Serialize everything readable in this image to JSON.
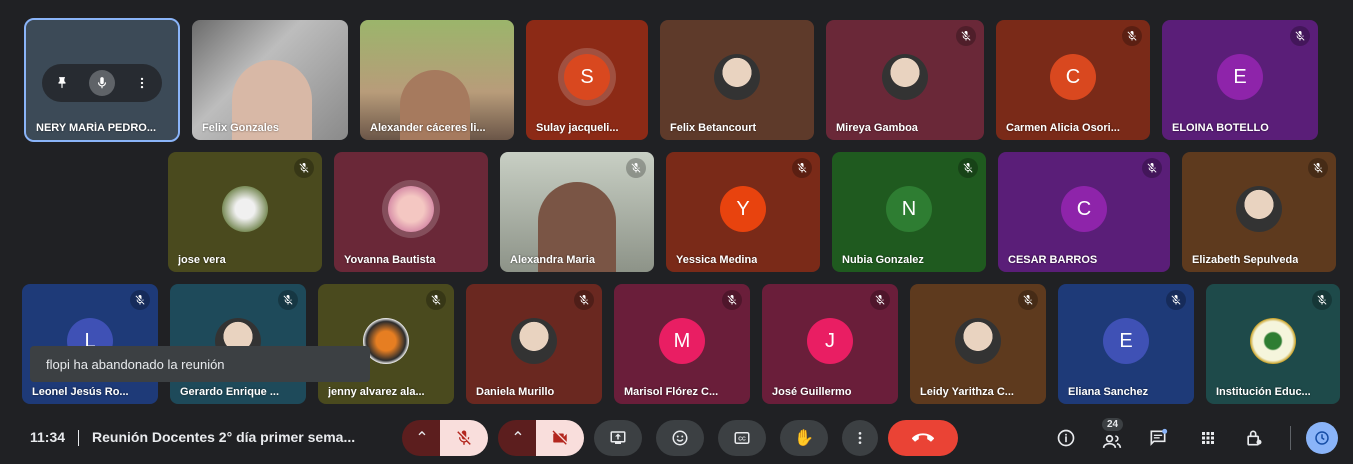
{
  "colors": {
    "accent": "#8ab4f8",
    "hangup": "#ea4335",
    "mute_bg": "#f9dedc",
    "bar_bg": "#202124"
  },
  "self_tile": {
    "name": "NERY MARÍA PEDRO..."
  },
  "self_controls": {
    "pin_icon": "pin-icon",
    "mic_icon": "mic-icon",
    "more_icon": "more-vert-icon"
  },
  "tiles": [
    {
      "name": "Felix Gonzales"
    },
    {
      "name": "Alexander cáceres li..."
    },
    {
      "name": "Sulay jacqueli...",
      "initial": "S"
    },
    {
      "name": "Felix Betancourt"
    },
    {
      "name": "Mireya Gamboa"
    },
    {
      "name": "Carmen Alicia Osori...",
      "initial": "C"
    },
    {
      "name": "ELOINA BOTELLO",
      "initial": "E"
    },
    {
      "name": "jose vera"
    },
    {
      "name": "Yovanna Bautista"
    },
    {
      "name": "Alexandra Maria"
    },
    {
      "name": "Yessica Medina",
      "initial": "Y"
    },
    {
      "name": "Nubia Gonzalez",
      "initial": "N"
    },
    {
      "name": "CESAR BARROS",
      "initial": "C"
    },
    {
      "name": "Elizabeth Sepulveda"
    },
    {
      "name": "Leonel Jesús Ro...",
      "initial": "L"
    },
    {
      "name": "Gerardo Enrique ..."
    },
    {
      "name": "jenny alvarez ala..."
    },
    {
      "name": "Daniela Murillo"
    },
    {
      "name": "Marisol Flórez C...",
      "initial": "M"
    },
    {
      "name": "José Guillermo",
      "initial": "J"
    },
    {
      "name": "Leidy Yarithza C..."
    },
    {
      "name": "Eliana Sanchez",
      "initial": "E"
    },
    {
      "name": "Institución Educ..."
    }
  ],
  "toast": {
    "text": "flopi ha abandonado la reunión"
  },
  "bottom_bar": {
    "time": "11:34",
    "meeting_title": "Reunión Docentes 2° día primer sema...",
    "people_count": "24"
  }
}
